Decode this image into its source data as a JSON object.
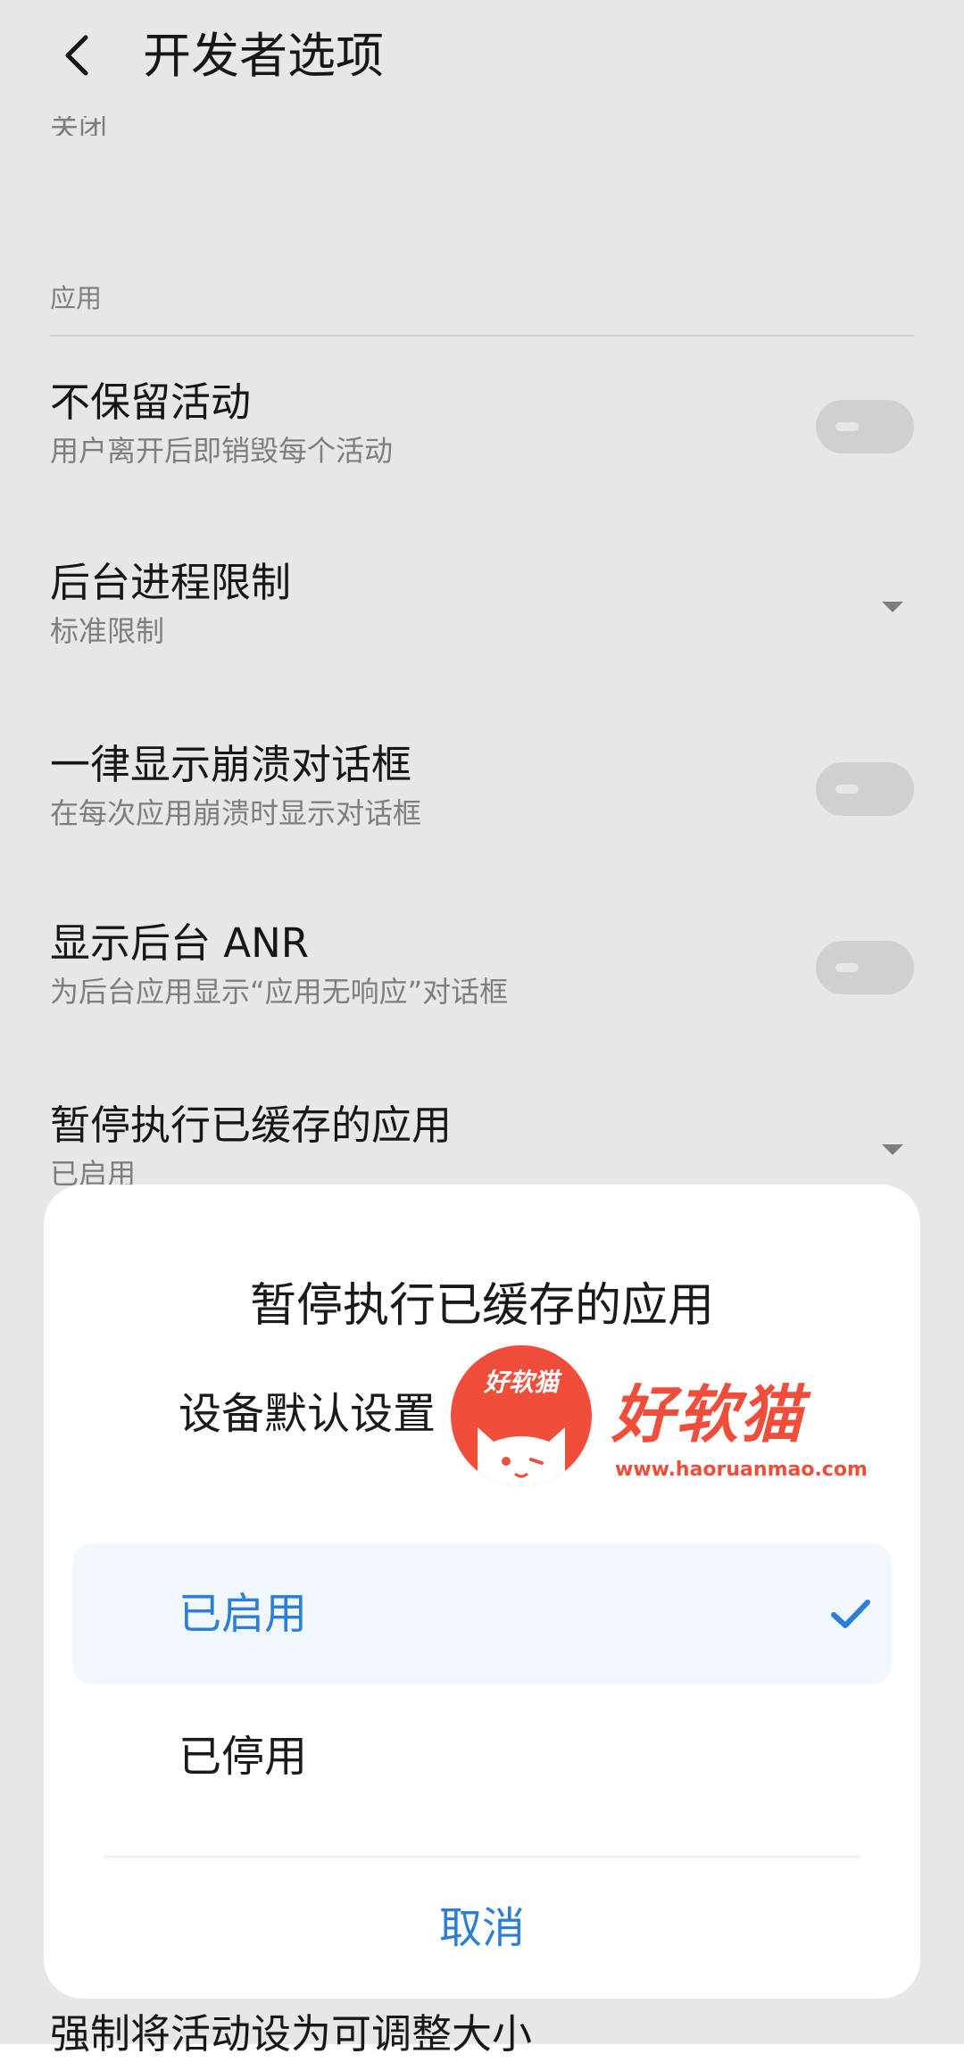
{
  "header": {
    "title": "开发者选项"
  },
  "peek_text": "关闭",
  "section": {
    "label": "应用"
  },
  "rows": [
    {
      "title": "不保留活动",
      "subtitle": "用户离开后即销毁每个活动",
      "control": "toggle",
      "state": "off"
    },
    {
      "title": "后台进程限制",
      "subtitle": "标准限制",
      "control": "dropdown"
    },
    {
      "title": "一律显示崩溃对话框",
      "subtitle": "在每次应用崩溃时显示对话框",
      "control": "toggle",
      "state": "off"
    },
    {
      "title": "显示后台 ANR",
      "subtitle": "为后台应用显示“应用无响应”对话框",
      "control": "toggle",
      "state": "off"
    },
    {
      "title": "暂停执行已缓存的应用",
      "subtitle": "已启用",
      "control": "dropdown"
    }
  ],
  "bottom_peek": "强制将活动设为可调整大小",
  "dialog": {
    "title": "暂停执行已缓存的应用",
    "options": [
      {
        "label": "设备默认设置",
        "selected": false
      },
      {
        "label": "已启用",
        "selected": true
      },
      {
        "label": "已停用",
        "selected": false
      }
    ],
    "cancel_label": "取消"
  },
  "watermark": {
    "circle_text": "好软猫",
    "brand": "好软猫",
    "url": "www.haoruanmao.com"
  },
  "colors": {
    "accent": "#2c7fd6",
    "selected_bg": "#f2f7fd",
    "watermark": "#f04e3b",
    "secondary_text": "#8c8c8c"
  },
  "icons": {
    "back": "chevron-left-icon",
    "dropdown": "triangle-down-icon",
    "check": "check-icon"
  }
}
